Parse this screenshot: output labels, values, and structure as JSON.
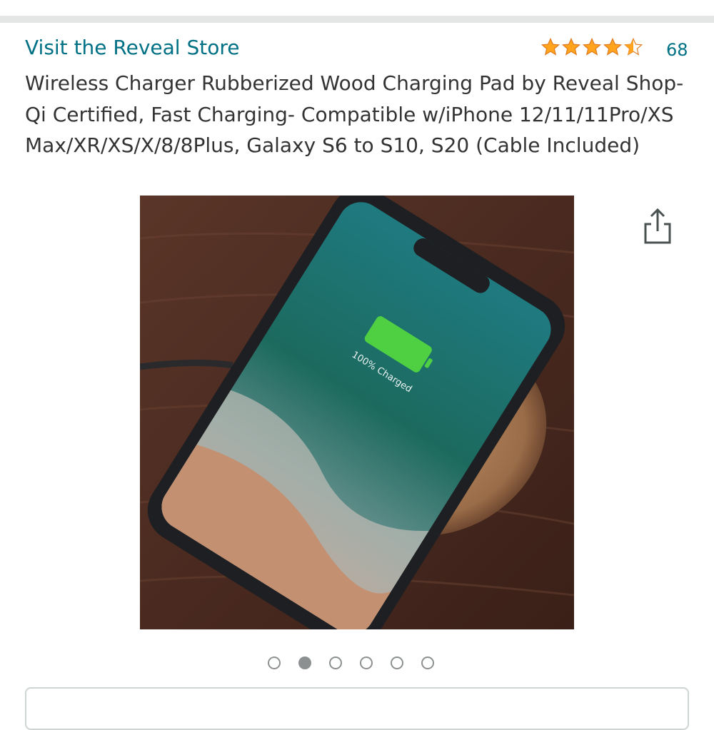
{
  "header": {
    "store_link": "Visit the Reveal Store",
    "rating_stars": 4.5,
    "rating_count": "68"
  },
  "product": {
    "title": "Wireless Charger Rubberized Wood Charging Pad by Reveal Shop- Qi Certified, Fast Charging- Compatible w/iPhone 12/11/11Pro/XS Max/XR/XS/X/8/8Plus, Galaxy S6 to S10, S20 (Cable Included)",
    "image_overlay_text": "100% Charged"
  },
  "gallery": {
    "total_images": 6,
    "active_index": 1
  },
  "icons": {
    "share": "share-icon",
    "star": "star-icon"
  },
  "colors": {
    "link": "#007185",
    "star": "#ffa41c",
    "divider": "#e4e6e6"
  }
}
